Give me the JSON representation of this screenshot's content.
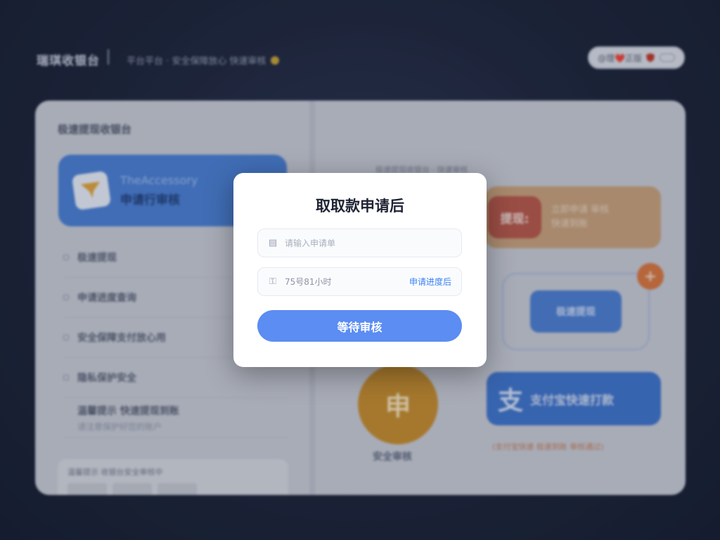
{
  "header": {
    "brand": "瑞琪收银台",
    "subtitle": "平台平台 · 安全保障放心 快速审核",
    "status_pill": "@理❤️正版"
  },
  "left_panel": {
    "title": "极速提现收银台",
    "feature_tile": {
      "line1": "TheAccessory",
      "line2": "申请行审核"
    },
    "list": [
      "极速提现",
      "申请进度查询",
      "安全保障支付放心用",
      "隐私保护安全"
    ],
    "multi_row": {
      "main": "温馨提示 快速提现到账",
      "sub": "请注意保护好您的账户"
    },
    "footer_text": "温馨提示 收银台安全审核中"
  },
  "right_panel": {
    "caption": "极速提现收银台 · 快速审核",
    "orange_badge": "提现:",
    "orange_text": "立即申请 审核\n快速到账",
    "outline_button": "极速提现",
    "plus_label": "+",
    "seal_char": "申",
    "seal_caption": "安全审核",
    "pay_char": "支",
    "pay_label": "支付宝快速打款",
    "pay_note": "(支付宝快速 极速到账 审核通过)"
  },
  "modal": {
    "title": "取取款申请后",
    "field1_placeholder": "请输入申请单",
    "field2_value": "75号81小时",
    "field2_link": "申请进度后",
    "submit_label": "等待审核",
    "field1_icon": "document-icon",
    "field2_icon": "lock-icon"
  },
  "colors": {
    "accent": "#5b8df2",
    "link": "#3b82f6",
    "background": "#1c2439"
  }
}
